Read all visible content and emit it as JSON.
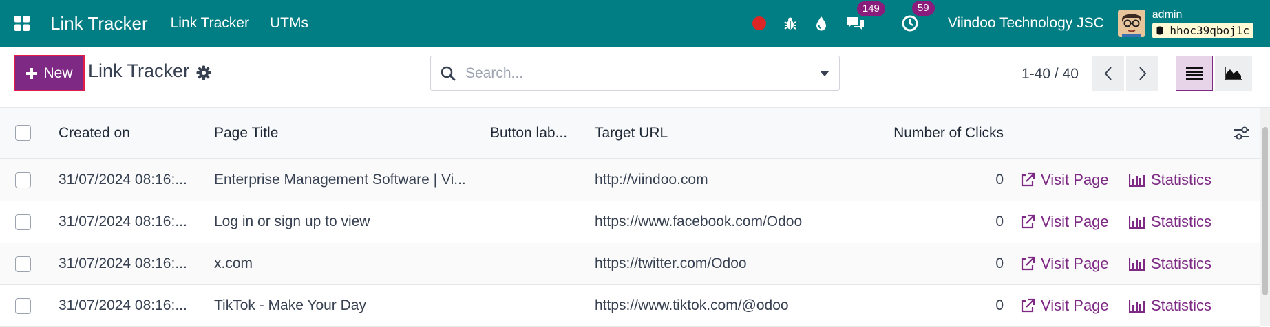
{
  "navbar": {
    "app_name": "Link Tracker",
    "menus": [
      "Link Tracker",
      "UTMs"
    ],
    "messages_count": "149",
    "activities_count": "59",
    "company": "Viindoo Technology JSC",
    "user": "admin",
    "database": "hhoc39qboj1c",
    "icons": [
      "apps-grid-icon",
      "record-dot-icon",
      "bug-icon",
      "droplet-icon",
      "chat-icon",
      "clock-icon",
      "database-icon"
    ]
  },
  "control": {
    "new_label": "New",
    "title": "Link Tracker",
    "search_placeholder": "Search...",
    "pager": "1-40 / 40"
  },
  "table": {
    "columns": [
      "Created on",
      "Page Title",
      "Button lab...",
      "Target URL",
      "Number of Clicks"
    ],
    "rows": [
      {
        "created": "31/07/2024 08:16:...",
        "title": "Enterprise Management Software | Vi...",
        "button": "",
        "url": "http://viindoo.com",
        "clicks": "0"
      },
      {
        "created": "31/07/2024 08:16:...",
        "title": "Log in or sign up to view",
        "button": "",
        "url": "https://www.facebook.com/Odoo",
        "clicks": "0"
      },
      {
        "created": "31/07/2024 08:16:...",
        "title": "x.com",
        "button": "",
        "url": "https://twitter.com/Odoo",
        "clicks": "0"
      },
      {
        "created": "31/07/2024 08:16:...",
        "title": "TikTok - Make Your Day",
        "button": "",
        "url": "https://www.tiktok.com/@odoo",
        "clicks": "0"
      }
    ],
    "visit_label": "Visit Page",
    "stats_label": "Statistics"
  },
  "colors": {
    "navbar": "#017e84",
    "primary": "#7e2a85",
    "badge": "#8a1d7c"
  }
}
